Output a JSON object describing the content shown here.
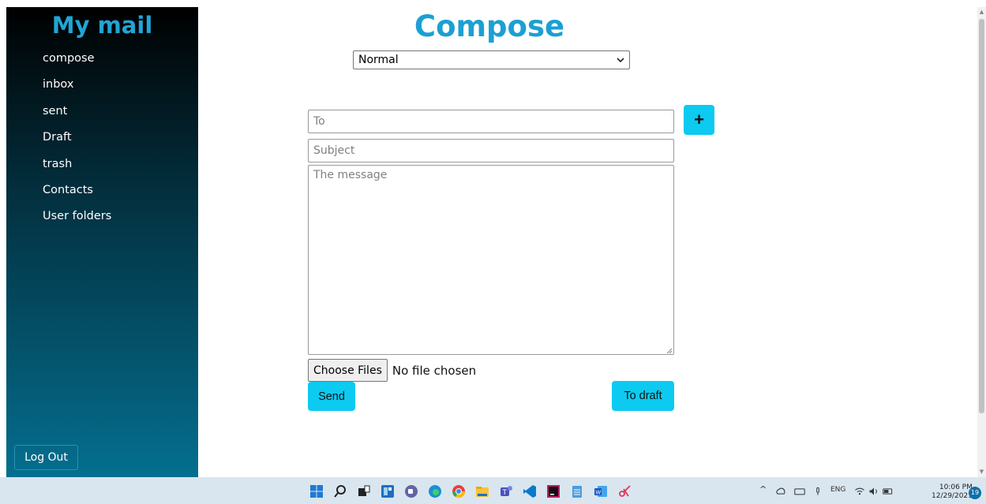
{
  "sidebar": {
    "title": "My mail",
    "items": [
      {
        "label": "compose"
      },
      {
        "label": "inbox"
      },
      {
        "label": "sent"
      },
      {
        "label": "Draft"
      },
      {
        "label": "trash"
      },
      {
        "label": "Contacts"
      },
      {
        "label": "User folders"
      }
    ],
    "logout_label": "Log Out"
  },
  "main": {
    "title": "Compose",
    "priority": {
      "selected": "Normal"
    },
    "to_placeholder": "To",
    "subject_placeholder": "Subject",
    "message_placeholder": "The message",
    "add_recipient_label": "+",
    "file": {
      "button_label": "Choose Files",
      "status": "No file chosen"
    },
    "send_label": "Send",
    "draft_label": "To draft"
  },
  "taskbar": {
    "tray_language": "ENG",
    "time": "10:06 PM",
    "date": "12/29/2021",
    "notification_count": "19"
  },
  "colors": {
    "accent": "#0dcaf0",
    "title": "#1ba0d3",
    "sidebar_top": "#000000",
    "sidebar_bottom": "#046f8f"
  }
}
